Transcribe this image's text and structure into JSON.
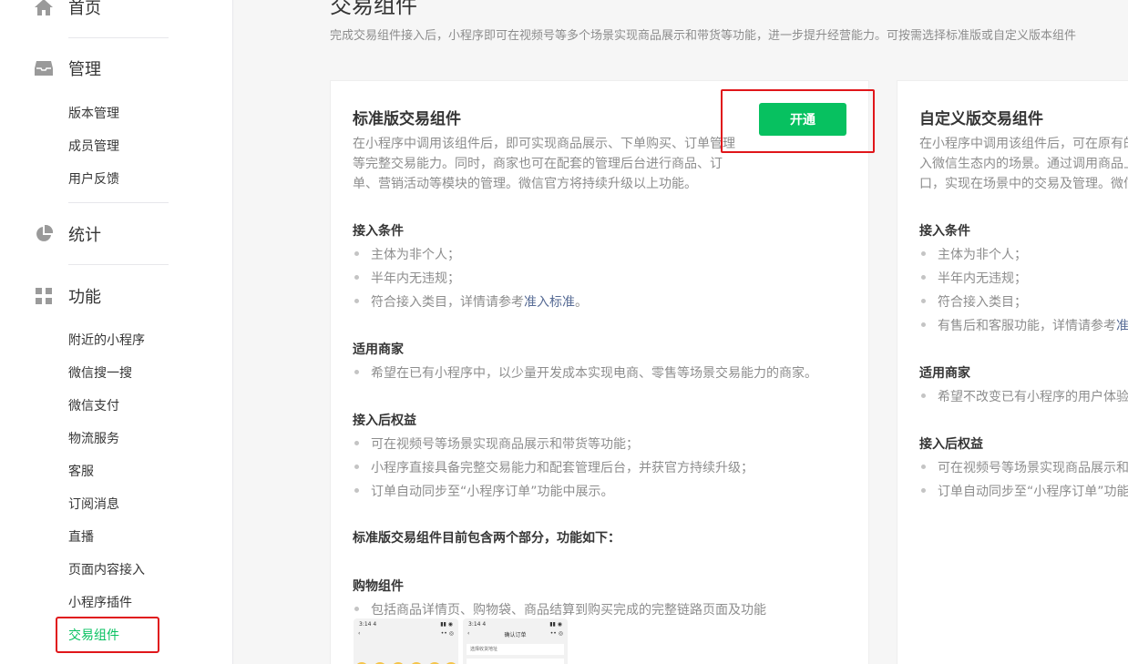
{
  "sidebar": {
    "home": "首页",
    "manage": "管理",
    "manage_items": [
      "版本管理",
      "成员管理",
      "用户反馈"
    ],
    "stats": "统计",
    "features": "功能",
    "feature_items": [
      "附近的小程序",
      "微信搜一搜",
      "微信支付",
      "物流服务",
      "客服",
      "订阅消息",
      "直播",
      "页面内容接入",
      "小程序插件",
      "交易组件"
    ]
  },
  "page": {
    "title": "交易组件",
    "desc": "完成交易组件接入后，小程序即可在视频号等多个场景实现商品展示和带货等功能，进一步提升经营能力。可按需选择标准版或自定义版本组件"
  },
  "standard": {
    "title": "标准版交易组件",
    "open_button": "开通",
    "desc": "在小程序中调用该组件后，即可实现商品展示、下单购买、订单管理等完整交易能力。同时，商家也可在配套的管理后台进行商品、订单、营销活动等模块的管理。微信官方将持续升级以上功能。",
    "cond_title": "接入条件",
    "cond_1": "主体为非个人；",
    "cond_2": "半年内无违规；",
    "cond_3_text": "符合接入类目，详情请参考",
    "cond_3_link": "准入标准",
    "cond_3_end": "。",
    "merchant_title": "适用商家",
    "merchant_1": "希望在已有小程序中，以少量开发成本实现电商、零售等场景交易能力的商家。",
    "benefit_title": "接入后权益",
    "benefit_1": "可在视频号等场景实现商品展示和带货等功能；",
    "benefit_2": "小程序直接具备完整交易能力和配套管理后台，并获官方持续升级；",
    "benefit_3": "订单自动同步至“小程序订单”功能中展示。",
    "parts_title": "标准版交易组件目前包含两个部分，功能如下：",
    "cart_title": "购物组件",
    "cart_1": "包括商品详情页、购物袋、商品结算到购买完成的完整链路页面及功能",
    "phone1_time": "3:14 4",
    "phone2_time": "3:14 4",
    "phone2_title": "确认订单",
    "phone2_addr": "选择收货地址"
  },
  "custom": {
    "title": "自定义版交易组件",
    "desc_1": "在小程序中调用该组件后，可在原有的",
    "desc_2": "入微信生态内的场景。通过调用商品上",
    "desc_3": "口，实现在场景中的交易及管理。微信",
    "cond_title": "接入条件",
    "cond_1": "主体为非个人；",
    "cond_2": "半年内无违规；",
    "cond_3": "符合接入类目；",
    "cond_4_text": "有售后和客服功能，详情请参考",
    "cond_4_link": "准",
    "merchant_title": "适用商家",
    "merchant_1": "希望不改变已有小程序的用户体验",
    "benefit_title": "接入后权益",
    "benefit_1": "可在视频号等场景实现商品展示和",
    "benefit_2": "订单自动同步至“小程序订单”功能"
  },
  "colors": {
    "accent": "#07c160",
    "highlight": "#e0161a",
    "link": "#576b95"
  }
}
